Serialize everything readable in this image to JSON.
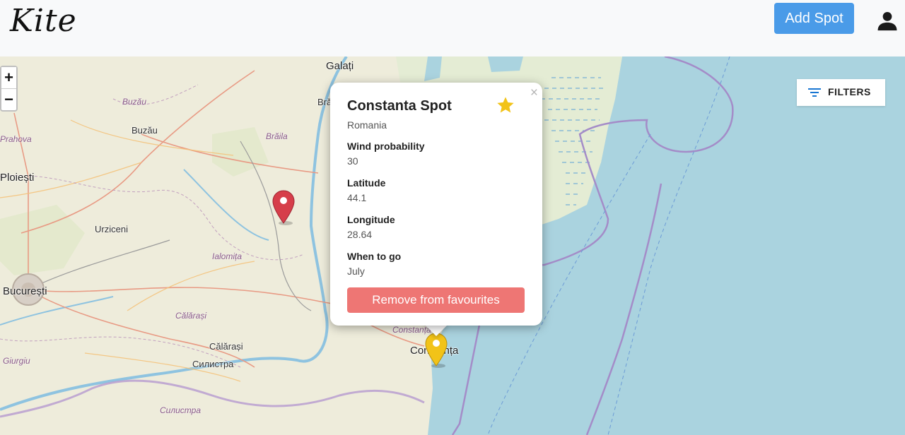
{
  "header": {
    "brand": "Kite",
    "add_spot_label": "Add Spot"
  },
  "map": {
    "zoom_in": "+",
    "zoom_out": "−",
    "filters_label": "FILTERS",
    "cities": [
      "Galați",
      "Buzău",
      "Ploiești",
      "Urziceni",
      "București",
      "Călărași",
      "Силистра",
      "Constanța",
      "Brăila"
    ],
    "counties": [
      "Buzău",
      "Prahova",
      "Brăila",
      "Ialomița",
      "Călărași",
      "Giurgiu",
      "Силистра",
      "Constanța"
    ],
    "markers": [
      {
        "color": "#d63e4a",
        "type": "spot"
      },
      {
        "color": "#f2c318",
        "type": "favourite"
      }
    ]
  },
  "popup": {
    "title": "Constanta Spot",
    "country": "Romania",
    "wind_label": "Wind probability",
    "wind_value": "30",
    "lat_label": "Latitude",
    "lat_value": "44.1",
    "lon_label": "Longitude",
    "lon_value": "28.64",
    "when_label": "When to go",
    "when_value": "July",
    "remove_label": "Remove from favourites",
    "close": "×",
    "star_color": "#f2c318"
  }
}
